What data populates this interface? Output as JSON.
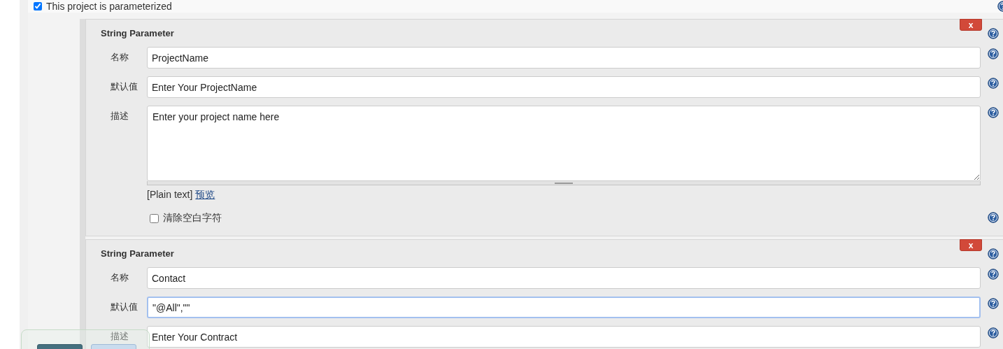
{
  "parameterized": {
    "label": "This project is parameterized",
    "checked": true
  },
  "parameters": [
    {
      "title": "String Parameter",
      "remove_label": "x",
      "fields": [
        {
          "kind": "text",
          "label": "名称",
          "value": "ProjectName",
          "focused": false
        },
        {
          "kind": "text",
          "label": "默认值",
          "value": "Enter Your ProjectName",
          "focused": false
        },
        {
          "kind": "textarea",
          "label": "描述",
          "value": "Enter your project name here",
          "focused": false
        }
      ],
      "format": "[Plain text]",
      "preview_link": "预览",
      "trim": {
        "label": "清除空白字符",
        "checked": false
      }
    },
    {
      "title": "String Parameter",
      "remove_label": "x",
      "fields": [
        {
          "kind": "text",
          "label": "名称",
          "value": "Contact",
          "focused": false
        },
        {
          "kind": "text",
          "label": "默认值",
          "value": "\"@All\",\"\"",
          "focused": true
        },
        {
          "kind": "text",
          "label": "描述",
          "value": "Enter Your Contract",
          "focused": false
        }
      ]
    }
  ]
}
